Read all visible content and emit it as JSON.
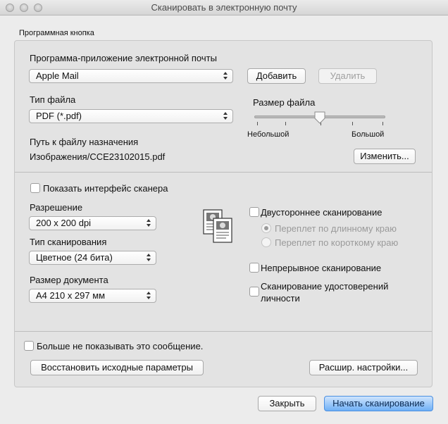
{
  "window": {
    "title": "Сканировать в электронную почту"
  },
  "group": {
    "label": "Программная кнопка"
  },
  "email_app": {
    "label": "Программа-приложение электронной почты",
    "selected": "Apple Mail",
    "add_label": "Добавить",
    "remove_label": "Удалить"
  },
  "file_type": {
    "label": "Тип файла",
    "selected": "PDF (*.pdf)"
  },
  "file_size": {
    "label": "Размер файла",
    "min_label": "Небольшой",
    "max_label": "Большой",
    "value_fraction": 0.5
  },
  "destination": {
    "label": "Путь к файлу назначения",
    "value": "Изображения/CCE23102015.pdf",
    "change_label": "Изменить..."
  },
  "scanner_ui": {
    "label": "Показать интерфейс сканера",
    "checked": false
  },
  "resolution": {
    "label": "Разрешение",
    "selected": "200 x 200  dpi"
  },
  "scan_type": {
    "label": "Тип сканирования",
    "selected": "Цветное (24 бита)"
  },
  "doc_size": {
    "label": "Размер документа",
    "selected": "A4 210 x 297 мм"
  },
  "duplex": {
    "label": "Двустороннее сканирование",
    "checked": false,
    "long_edge": "Переплет по длинному краю",
    "short_edge": "Переплет по короткому краю"
  },
  "continuous": {
    "label": "Непрерывное сканирование",
    "checked": false
  },
  "id_card": {
    "label_line1": "Сканирование удостоверений",
    "label_line2": "личности",
    "checked": false
  },
  "dont_show": {
    "label": "Больше не показывать это сообщение.",
    "checked": false
  },
  "buttons": {
    "restore_defaults": "Восстановить исходные параметры",
    "advanced": "Расшир. настройки...",
    "close": "Закрыть",
    "start_scan": "Начать сканирование"
  },
  "icons": [
    "close-light-icon",
    "minimize-light-icon",
    "zoom-light-icon",
    "duplex-pages-icon"
  ]
}
